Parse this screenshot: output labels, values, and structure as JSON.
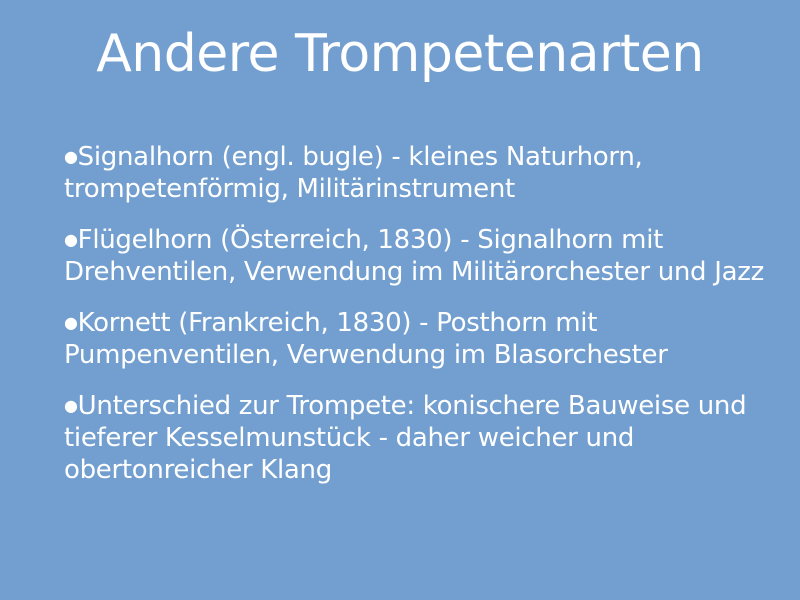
{
  "slide": {
    "title": "Andere Trompetenarten",
    "bullets": [
      {
        "text": "Signalhorn (engl. bugle) - kleines Naturhorn, trompetenförmig, Militärinstrument"
      },
      {
        "text": "Flügelhorn (Österreich, 1830) - Signalhorn mit Drehventilen, Verwendung im Militärorchester und Jazz"
      },
      {
        "text": "Kornett (Frankreich, 1830) - Posthorn mit Pumpenventilen, Verwendung im Blasorchester"
      },
      {
        "text": "Unterschied zur Trompete: konischere Bauweise und tieferer Kesselmunstück - daher weicher und obertonreicher Klang"
      }
    ],
    "bullet_symbol": "●",
    "background_color": "#729fcf",
    "text_color": "#ffffff"
  }
}
